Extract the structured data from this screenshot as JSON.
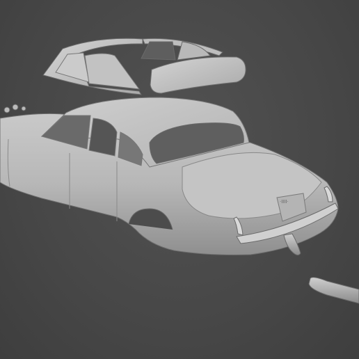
{
  "viewport": {
    "background": "#4a4a4a",
    "model_color": "#bdbdbd",
    "model_shadow": "#7a7a7a"
  },
  "scene": {
    "objects": [
      "car-body",
      "side-window-glass-set",
      "rear-windscreen-glass",
      "exhaust-pipe",
      "rear-bumper-piece"
    ]
  }
}
